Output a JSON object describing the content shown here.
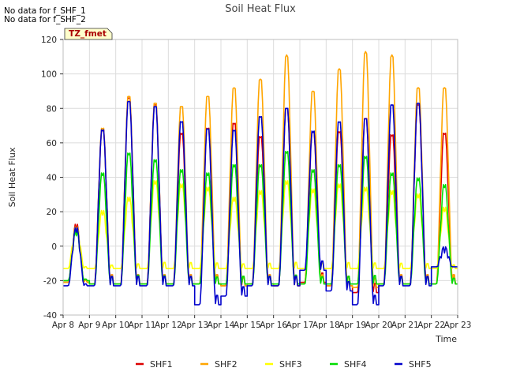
{
  "notes": [
    "No data for f_SHF_1",
    "No data for f_SHF_2"
  ],
  "chart_data": {
    "type": "line",
    "title": "Soil Heat Flux",
    "xlabel": "Time",
    "ylabel": "Soil Heat Flux",
    "site_label": "TZ_fmet",
    "xlim": [
      "2024-04-08",
      "2024-04-23"
    ],
    "ylim": [
      -40,
      120
    ],
    "x_ticks": [
      "Apr 8",
      "Apr 9",
      "Apr 10",
      "Apr 11",
      "Apr 12",
      "Apr 13",
      "Apr 14",
      "Apr 15",
      "Apr 16",
      "Apr 17",
      "Apr 18",
      "Apr 19",
      "Apr 20",
      "Apr 21",
      "Apr 22",
      "Apr 23"
    ],
    "y_ticks": [
      -40,
      -20,
      0,
      20,
      40,
      60,
      80,
      100,
      120
    ],
    "grid": true,
    "legend_position": "bottom",
    "days": [
      "2024-04-08",
      "2024-04-09",
      "2024-04-10",
      "2024-04-11",
      "2024-04-12",
      "2024-04-13",
      "2024-04-14",
      "2024-04-15",
      "2024-04-16",
      "2024-04-17",
      "2024-04-18",
      "2024-04-19",
      "2024-04-20",
      "2024-04-21",
      "2024-04-22"
    ],
    "series": [
      {
        "name": "SHF1",
        "color": "#dd0000",
        "daily_peak": [
          14,
          71,
          90,
          86,
          69,
          72,
          75,
          67,
          84,
          70,
          70,
          78,
          68,
          86,
          69
        ],
        "daily_min": [
          -21,
          -22,
          -22,
          -22,
          -22,
          -22,
          -23,
          -22,
          -23,
          -21,
          -23,
          -27,
          -22,
          -22,
          -22
        ]
      },
      {
        "name": "SHF2",
        "color": "#ffa500",
        "daily_peak": [
          12,
          72,
          91,
          87,
          85,
          91,
          96,
          101,
          115,
          94,
          107,
          117,
          115,
          96,
          96
        ],
        "daily_min": [
          -21,
          -22,
          -22,
          -22,
          -22,
          -22,
          -23,
          -22,
          -23,
          -22,
          -23,
          -24,
          -22,
          -22,
          -22
        ]
      },
      {
        "name": "SHF3",
        "color": "#ffff00",
        "daily_peak": [
          12,
          22,
          30,
          40,
          38,
          36,
          30,
          34,
          40,
          35,
          38,
          36,
          34,
          32,
          24
        ],
        "daily_min": [
          -13,
          -13,
          -13,
          -13,
          -13,
          -13,
          -13,
          -13,
          -13,
          -13,
          -13,
          -13,
          -13,
          -13,
          -13
        ]
      },
      {
        "name": "SHF4",
        "color": "#00dd00",
        "daily_peak": [
          10,
          45,
          57,
          53,
          47,
          45,
          50,
          50,
          58,
          47,
          50,
          55,
          45,
          42,
          38
        ],
        "daily_min": [
          -20,
          -22,
          -22,
          -22,
          -22,
          -22,
          -22,
          -22,
          -22,
          -22,
          -22,
          -22,
          -22,
          -22,
          -22
        ]
      },
      {
        "name": "SHF5",
        "color": "#0000cc",
        "daily_peak": [
          12,
          71,
          88,
          85,
          76,
          72,
          71,
          79,
          84,
          70,
          76,
          78,
          86,
          87,
          0
        ],
        "daily_min": [
          -23,
          -23,
          -23,
          -23,
          -23,
          -34,
          -29,
          -23,
          -23,
          -14,
          -26,
          -34,
          -23,
          -23,
          -12
        ]
      }
    ]
  }
}
